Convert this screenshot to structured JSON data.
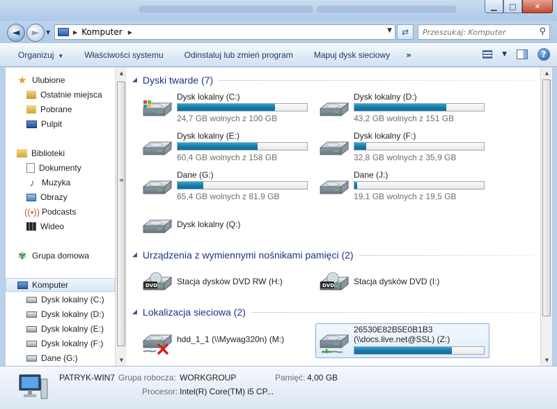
{
  "window": {
    "minimize": "▁",
    "maximize": "□",
    "close": "✕"
  },
  "address": {
    "crumb": "Komputer",
    "search_placeholder": "Przeszukaj: Komputer"
  },
  "toolbar": {
    "organize": "Organizuj",
    "system_properties": "Właściwości systemu",
    "uninstall": "Odinstaluj lub zmień program",
    "map_drive": "Mapuj dysk sieciowy",
    "more": "»",
    "help": "?"
  },
  "nav": {
    "favorites": "Ulubione",
    "recent": "Ostatnie miejsca",
    "downloads": "Pobrane",
    "desktop": "Pulpit",
    "libraries": "Biblioteki",
    "documents": "Dokumenty",
    "music": "Muzyka",
    "pictures": "Obrazy",
    "podcasts": "Podcasts",
    "videos": "Wideo",
    "homegroup": "Grupa domowa",
    "computer": "Komputer",
    "drive_c": "Dysk lokalny (C:)",
    "drive_d": "Dysk lokalny (D:)",
    "drive_e": "Dysk lokalny (E:)",
    "drive_f": "Dysk lokalny (F:)",
    "drive_g": "Dane (G:)"
  },
  "groups": {
    "hard_drives": "Dyski twarde (7)",
    "removable": "Urządzenia z wymiennymi nośnikami pamięci (2)",
    "network": "Lokalizacja sieciowa (2)"
  },
  "drives": [
    {
      "name": "Dysk lokalny (C:)",
      "free": "24,7 GB wolnych z 100 GB",
      "used_fraction": 0.75
    },
    {
      "name": "Dysk lokalny (D:)",
      "free": "43,2 GB wolnych z 151 GB",
      "used_fraction": 0.71
    },
    {
      "name": "Dysk lokalny (E:)",
      "free": "60,4 GB wolnych z 158 GB",
      "used_fraction": 0.62
    },
    {
      "name": "Dysk lokalny (F:)",
      "free": "32,8 GB wolnych z 35,9 GB",
      "used_fraction": 0.09
    },
    {
      "name": "Dane (G:)",
      "free": "65,4 GB wolnych z 81,9 GB",
      "used_fraction": 0.2
    },
    {
      "name": "Dane (J:)",
      "free": "19,1 GB wolnych z 19,5 GB",
      "used_fraction": 0.02
    },
    {
      "name": "Dysk lokalny (Q:)"
    }
  ],
  "removable": [
    {
      "name": "Stacja dysków DVD RW (H:)"
    },
    {
      "name": "Stacja dysków DVD (I:)"
    }
  ],
  "dvd_badge": "DVD",
  "network": [
    {
      "name": "hdd_1_1 (\\\\Mywag320n) (M:)"
    },
    {
      "name_line1": "26530E82B5E0B1B3",
      "name_line2": "(\\\\docs.live.net@SSL) (Z:)",
      "used_fraction": 0.75
    }
  ],
  "status": {
    "computer_name": "PATRYK-WIN7",
    "workgroup_label": "Grupa robocza:",
    "workgroup": "WORKGROUP",
    "memory_label": "Pamięć:",
    "memory": "4,00 GB",
    "cpu_label": "Procesor:",
    "cpu": "Intel(R) Core(TM) i5 CP..."
  }
}
